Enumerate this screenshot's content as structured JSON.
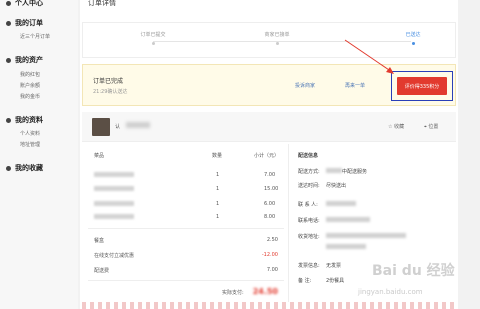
{
  "sidebar": {
    "personal_center": "个人中心",
    "my_orders": "我的订单",
    "recent_orders": "近三个月订单",
    "my_assets": "我的资产",
    "assets_items": [
      "我的红包",
      "账户余额",
      "我的金币"
    ],
    "my_profile": "我的资料",
    "profile_items": [
      "个人资料",
      "地址管理"
    ],
    "my_favorites": "我的收藏"
  },
  "page": {
    "title": "订单详情"
  },
  "progress": {
    "steps": [
      "订单已提交",
      "商家已接单",
      "已送达"
    ],
    "active_index": 2
  },
  "status": {
    "title": "订单已完成",
    "subtitle": "21:29确认送达",
    "link_complaint": "投诉商家",
    "link_reorder": "再来一单",
    "review_button": "评价得335积分"
  },
  "shop": {
    "name": "认",
    "favorite": "收藏",
    "location": "位置"
  },
  "items": {
    "headers": [
      "菜品",
      "数量",
      "小计（元）"
    ],
    "rows": [
      {
        "qty": "1",
        "price": "7.00"
      },
      {
        "qty": "1",
        "price": "15.00"
      },
      {
        "qty": "1",
        "price": "6.00"
      },
      {
        "qty": "1",
        "price": "8.00"
      }
    ]
  },
  "summary": {
    "rows": [
      {
        "label": "餐盒",
        "value": "2.50"
      },
      {
        "label": "在线支付立减优惠",
        "value": "-12.00"
      },
      {
        "label": "配送费",
        "value": "7.00"
      }
    ],
    "actual_label": "实际支付:",
    "actual_value": "24.50"
  },
  "delivery": {
    "title": "配送信息",
    "method_label": "配送方式:",
    "method_value": "中配送服务",
    "time_label": "送达时间:",
    "time_value": "尽快送出",
    "contact_label": "联 系 人:",
    "phone_label": "联系电话:",
    "address_label": "收货地址:",
    "invoice_label": "发票信息:",
    "invoice_value": "无发票",
    "note_label": "备  注:",
    "note_value": "2份餐具"
  },
  "watermark": {
    "brand": "Bai du 经验",
    "url": "jingyan.baidu.com"
  },
  "colors": {
    "accent_red": "#e23a2e",
    "link_blue": "#4a90e2",
    "highlight_box": "#2a3fb8"
  }
}
